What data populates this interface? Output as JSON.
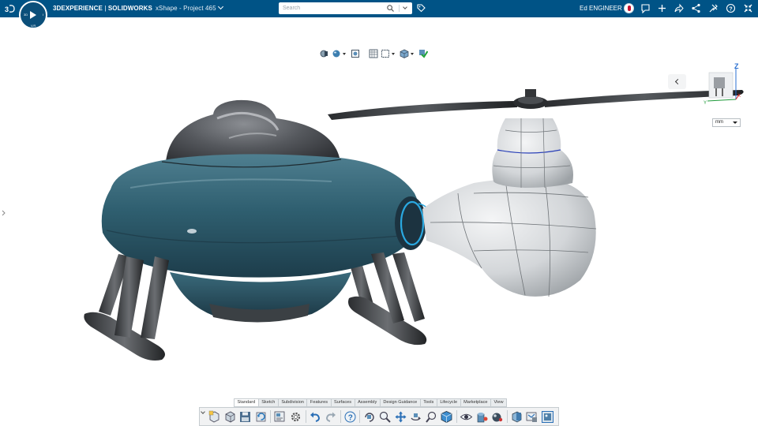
{
  "topbar": {
    "brand_bold": "3DEXPERIENCE",
    "brand_sep": " | ",
    "brand_product": "SOLIDWORKS",
    "app_name": "xShape - Project 465",
    "search_placeholder": "Search",
    "user_name": "Ed ENGINEER",
    "compass_quadrants": [
      "3D",
      "V,R",
      "I"
    ],
    "icons": [
      "3ds-logo-icon",
      "compass-icon",
      "search-icon",
      "tag-icon",
      "avatar",
      "feedback-icon",
      "add-icon",
      "share-icon",
      "network-icon",
      "tools-icon",
      "help-icon",
      "collapse-icon"
    ]
  },
  "view_toolbar": {
    "icons": [
      "section-view-icon",
      "display-style-icon",
      "zoom-to-fit-icon",
      "grid-icon",
      "selection-box-icon",
      "view-cube-icon",
      "accept-check-icon"
    ]
  },
  "viewport": {
    "units": "mm",
    "triad_axes": {
      "z": "Z",
      "x": "X",
      "y": "Y"
    },
    "colors": {
      "body_teal": "#2f5f70",
      "dome_dark": "#4a4d52",
      "tail_gray": "#d9dbde",
      "highlight": "#2aa8e0",
      "topbar": "#005386"
    }
  },
  "command_tabs": [
    "Standard",
    "Sketch",
    "Subdivision",
    "Features",
    "Surfaces",
    "Assembly",
    "Design Guidance",
    "Tools",
    "Lifecycle",
    "Marketplace",
    "View"
  ],
  "active_tab": "Standard",
  "command_bar": {
    "icons": [
      "new-part-icon",
      "3d-part-icon",
      "save-icon",
      "rebuild-icon",
      "layout-icon",
      "options-icon",
      "undo-icon",
      "redo-icon",
      "help-icon",
      "rotate-icon",
      "zoom-icon",
      "pan-icon",
      "roll-icon",
      "zoom-area-icon",
      "view-cube-icon",
      "hide-show-icon",
      "appearance-icon",
      "scene-icon",
      "section-icon",
      "display-manager-icon",
      "render-icon"
    ]
  }
}
